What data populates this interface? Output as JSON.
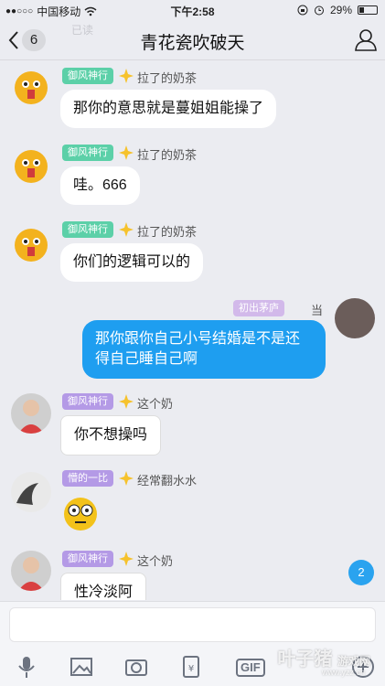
{
  "status_bar": {
    "carrier": "中国移动",
    "time": "下午2:58",
    "battery": "29%"
  },
  "nav": {
    "back_count": "6",
    "title": "青花瓷吹破天",
    "ghost_text": "已读"
  },
  "messages": [
    {
      "tag": "御风神行",
      "nick": "拉了的奶茶",
      "text": "那你的意思就是蔓姐姐能操了"
    },
    {
      "tag": "御风神行",
      "nick": "拉了的奶茶",
      "text": "哇。666"
    },
    {
      "tag": "御风神行",
      "nick": "拉了的奶茶",
      "text": "你们的逻辑可以的"
    },
    {
      "tag": "初出茅庐",
      "nick": "当",
      "text": "那你跟你自己小号结婚是不是还得自己睡自己啊"
    },
    {
      "tag": "御风神行",
      "nick": "这个奶",
      "text": "你不想操吗"
    },
    {
      "tag": "懵的一比",
      "nick": "经常翻水水",
      "text": ""
    },
    {
      "tag": "御风神行",
      "nick": "这个奶",
      "text": "性冷淡阿"
    }
  ],
  "unread_count": "2",
  "toolbar": {
    "gif_label": "GIF"
  },
  "watermark": {
    "name": "叶子猪",
    "sub": "游戏网",
    "url": "www.yzz.cn"
  },
  "colors": {
    "accent": "#1e9ef0",
    "tag_green": "#5cd0a8",
    "tag_purple": "#b49ae6"
  }
}
